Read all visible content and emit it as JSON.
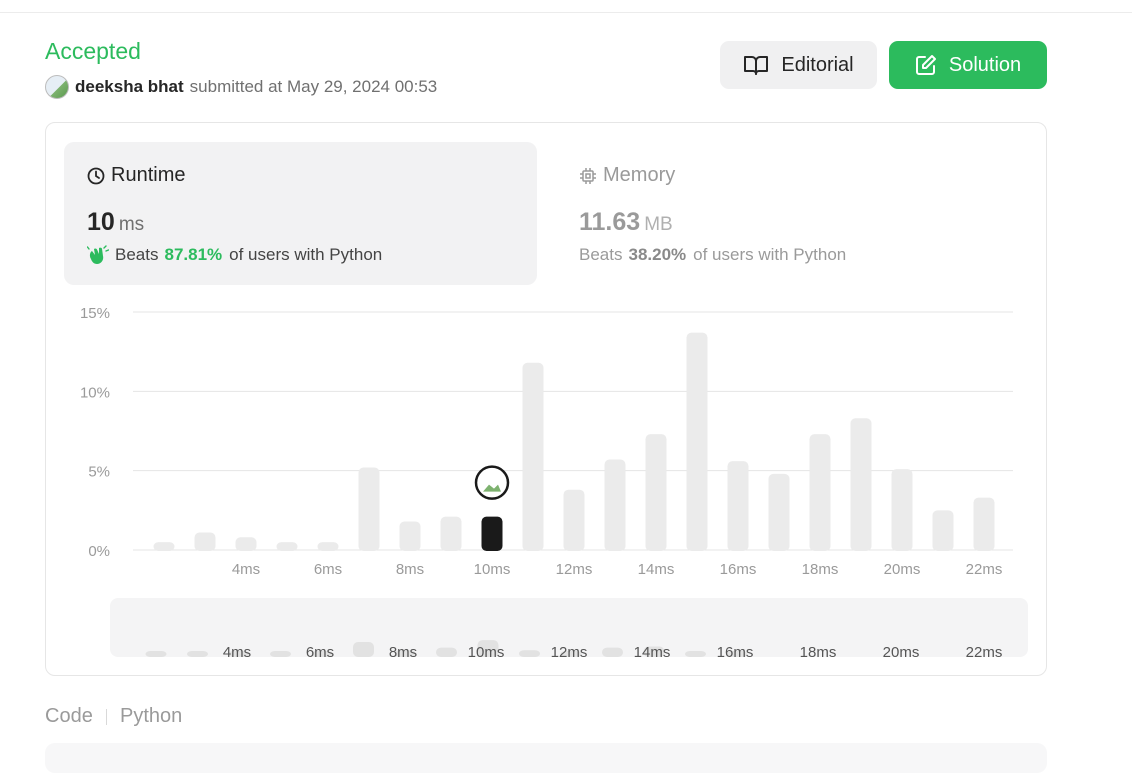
{
  "submission": {
    "status": "Accepted",
    "username": "deeksha bhat",
    "submitted_text": "submitted at May 29, 2024 00:53"
  },
  "buttons": {
    "editorial": "Editorial",
    "solution": "Solution"
  },
  "runtime": {
    "title": "Runtime",
    "value": "10",
    "unit": "ms",
    "beats_label": "Beats",
    "beats_pct": "87.81%",
    "beats_suffix": "of users with Python",
    "icon": "clock-icon",
    "beats_icon": "clapping-hands-icon"
  },
  "memory": {
    "title": "Memory",
    "value": "11.63",
    "unit": "MB",
    "beats_label": "Beats",
    "beats_pct": "38.20%",
    "beats_suffix": "of users with Python",
    "icon": "chip-icon"
  },
  "code": {
    "tab_code": "Code",
    "tab_language": "Python"
  },
  "colors": {
    "accent": "#2cbb5d",
    "bar": "#ebebeb",
    "selected_bar": "#1a1a1a"
  },
  "chart_data": {
    "type": "bar",
    "title": "",
    "xlabel": "",
    "ylabel": "",
    "ylim": [
      0,
      15
    ],
    "yticks": [
      "0%",
      "5%",
      "10%",
      "15%"
    ],
    "x_tick_labels": [
      "4ms",
      "6ms",
      "8ms",
      "10ms",
      "12ms",
      "14ms",
      "16ms",
      "18ms",
      "20ms",
      "22ms"
    ],
    "grid": true,
    "selected_index": 8,
    "values": [
      0.5,
      1.1,
      0.8,
      0.5,
      0.5,
      5.2,
      1.8,
      2.1,
      2.1,
      11.8,
      3.8,
      5.7,
      7.3,
      13.7,
      5.6,
      4.8,
      7.3,
      8.3,
      5.1,
      2.5,
      3.3
    ],
    "overview_values": [
      0.5,
      0.5,
      0.5,
      1.1,
      0.5,
      4.0,
      1.8,
      2.5,
      4.5,
      1.8,
      1.6,
      2.5,
      2.8,
      1.3,
      0.5
    ]
  }
}
